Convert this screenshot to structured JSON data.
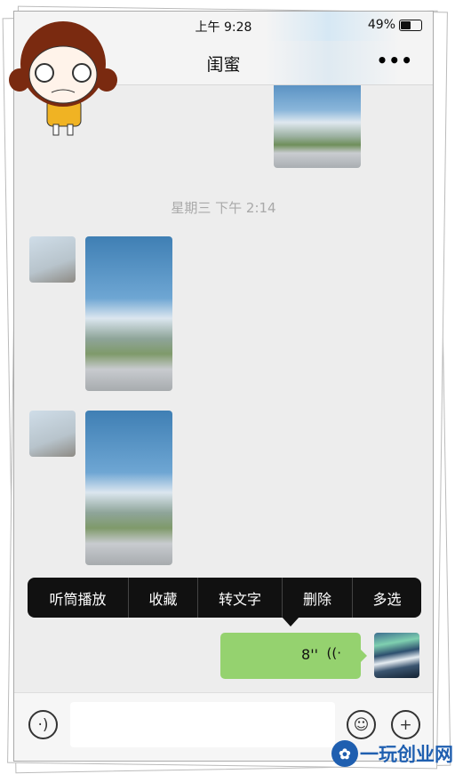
{
  "status_bar": {
    "time": "上午 9:28",
    "battery": "49%",
    "battery_level": 0.49
  },
  "nav": {
    "title": "闺蜜",
    "more_icon": "more-dots-icon",
    "more": "•••"
  },
  "chat": {
    "timestamp": "星期三 下午 2:14",
    "context_menu": [
      "听筒播放",
      "收藏",
      "转文字",
      "删除",
      "多选"
    ],
    "voice_message": {
      "duration": "8''",
      "icon": "voice-wave-icon"
    }
  },
  "input_bar": {
    "voice_icon": "voice-mode-icon",
    "emoji_icon": "emoji-icon",
    "plus_icon": "plus-icon"
  },
  "watermark": {
    "text": "一玩创业网"
  },
  "colors": {
    "bubble": "#95d26f",
    "menu": "#111111",
    "chat_bg": "#ededed"
  }
}
